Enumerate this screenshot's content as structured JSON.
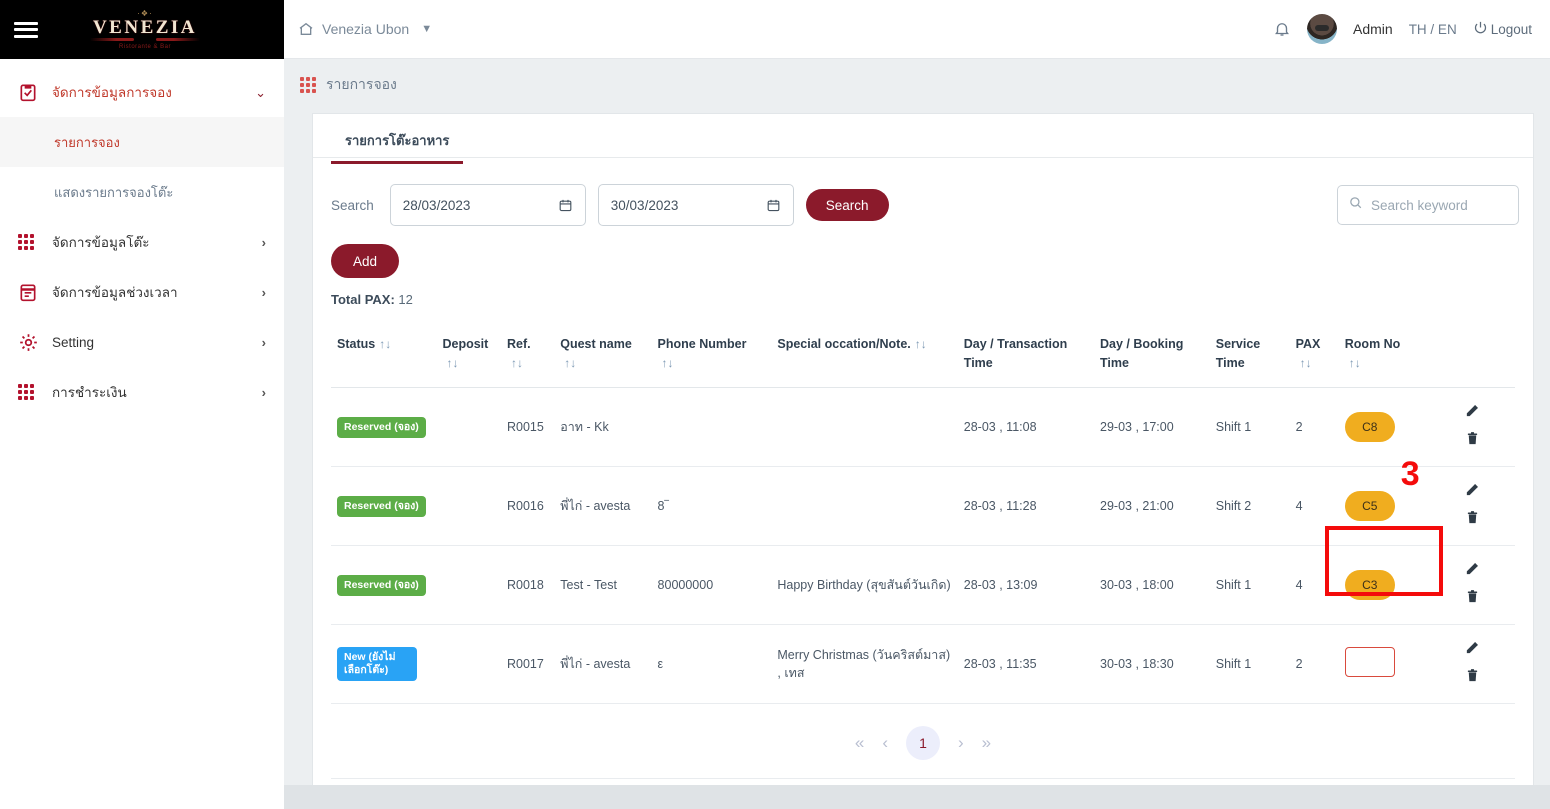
{
  "sidebar": {
    "logo": {
      "top_ornament": "·❖·",
      "text": "VENEZIA",
      "bottom_ornament": "Ristorante & Bar"
    },
    "menu_icon": "hamburger-icon",
    "items": [
      {
        "label": "จัดการข้อมูลการจอง",
        "icon": "clipboard-check-icon",
        "caret": "⌄",
        "expanded": true,
        "style": "red"
      },
      {
        "label": "จัดการข้อมูลโต๊ะ",
        "icon": "grid-dots-icon",
        "caret": "›",
        "expanded": false,
        "style": "dark"
      },
      {
        "label": "จัดการข้อมูลช่วงเวลา",
        "icon": "calendar-icon",
        "caret": "›",
        "expanded": false,
        "style": "dark"
      },
      {
        "label": "Setting",
        "icon": "gear-icon",
        "caret": "›",
        "expanded": false,
        "style": "dark"
      },
      {
        "label": "การชำระเงิน",
        "icon": "grid-dots-icon",
        "caret": "›",
        "expanded": false,
        "style": "dark"
      }
    ],
    "sub_items": [
      {
        "label": "รายการจอง",
        "active": true
      },
      {
        "label": "แสดงรายการจองโต๊ะ",
        "active": false
      }
    ]
  },
  "topbar": {
    "breadcrumb": "Venezia Ubon",
    "home_icon": "home-icon",
    "chevron_icon": "chevron-down-icon",
    "bell_icon": "bell-icon",
    "avatar": "user-avatar",
    "user_name": "Admin",
    "language": "TH / EN",
    "logout": "Logout",
    "power_icon": "power-icon"
  },
  "page": {
    "title": "รายการจอง",
    "grid_icon": "grid-dots-icon"
  },
  "tabs": [
    {
      "label": "รายการโต๊ะอาหาร",
      "active": true
    }
  ],
  "filters": {
    "search_label": "Search",
    "date_from": "28/03/2023",
    "date_to": "30/03/2023",
    "calendar_icon": "calendar-icon",
    "search_button": "Search",
    "keyword_placeholder": "Search keyword",
    "keyword_value": "",
    "search_icon": "search-icon"
  },
  "actions": {
    "add_button": "Add",
    "total_pax_label": "Total PAX:",
    "total_pax_value": "12"
  },
  "table": {
    "sort_icon": "↑↓",
    "columns": [
      {
        "label": "Status",
        "sortable": true,
        "inline_sort": true
      },
      {
        "label": "Deposit",
        "sortable": true
      },
      {
        "label": "Ref.",
        "sortable": true
      },
      {
        "label": "Quest name",
        "sortable": true
      },
      {
        "label": "Phone Number",
        "sortable": true
      },
      {
        "label": "Special occation/Note.",
        "sortable": true,
        "inline_sort": true
      },
      {
        "label": "Day / Transaction Time",
        "sortable": false
      },
      {
        "label": "Day / Booking Time",
        "sortable": false
      },
      {
        "label": "Service Time",
        "sortable": false
      },
      {
        "label": "PAX",
        "sortable": true
      },
      {
        "label": "Room No",
        "sortable": true
      },
      {
        "label": "",
        "sortable": false
      }
    ],
    "rows": [
      {
        "status": "Reserved (จอง)",
        "status_type": "reserved",
        "deposit": "",
        "ref": "R0015",
        "quest_name": "อาท - Kk",
        "phone": "",
        "note": "",
        "transaction_time": "28-03 , 11:08",
        "booking_time": "29-03 , 17:00",
        "service_time": "Shift 1",
        "pax": "2",
        "room_no": "C8",
        "room_empty": false,
        "highlight": false,
        "annotation": ""
      },
      {
        "status": "Reserved (จอง)",
        "status_type": "reserved",
        "deposit": "",
        "ref": "R0016",
        "quest_name": "พี่ไก่ - avesta",
        "phone": "8‾",
        "note": "",
        "transaction_time": "28-03 , 11:28",
        "booking_time": "29-03 , 21:00",
        "service_time": "Shift 2",
        "pax": "4",
        "room_no": "C5",
        "room_empty": false,
        "highlight": false,
        "annotation": "3"
      },
      {
        "status": "Reserved (จอง)",
        "status_type": "reserved",
        "deposit": "",
        "ref": "R0018",
        "quest_name": "Test - Test",
        "phone": "80000000",
        "note": "Happy Birthday (สุขสันต์วันเกิด)",
        "transaction_time": "28-03 , 13:09",
        "booking_time": "30-03 , 18:00",
        "service_time": "Shift 1",
        "pax": "4",
        "room_no": "C3",
        "room_empty": false,
        "highlight": true,
        "annotation": ""
      },
      {
        "status": "New (ยังไม่เลือกโต๊ะ)",
        "status_type": "new",
        "deposit": "",
        "ref": "R0017",
        "quest_name": "พี่ไก่ - avesta",
        "phone": "ε",
        "note": "Merry Christmas (วันคริสต์มาส) , เทส",
        "transaction_time": "28-03 , 11:35",
        "booking_time": "30-03 , 18:30",
        "service_time": "Shift 1",
        "pax": "2",
        "room_no": "",
        "room_empty": true,
        "highlight": false,
        "annotation": ""
      }
    ],
    "row_actions": {
      "edit_icon": "edit-pencil-icon",
      "delete_icon": "trash-icon"
    }
  },
  "pagination": {
    "first": "«",
    "prev": "‹",
    "current": "1",
    "next": "›",
    "last": "»"
  },
  "colors": {
    "brand": "#8b1a2b",
    "accent_red": "#b3122d",
    "reserved_green": "#5cad47",
    "new_blue": "#29a3f5",
    "room_pill": "#f0ad1f",
    "annotation_red": "#f40b0b"
  }
}
